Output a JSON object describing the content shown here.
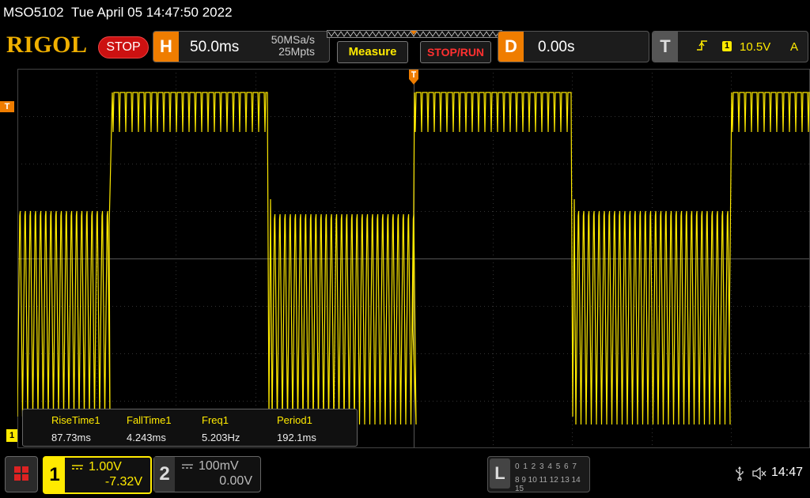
{
  "header": {
    "model": "MSO5102",
    "datetime": "Tue April 05 14:47:50 2022",
    "logo": "RIGOL",
    "run_state": "STOP"
  },
  "horizontal": {
    "badge": "H",
    "timebase": "50.0ms",
    "sample_rate": "50MSa/s",
    "memory_depth": "25Mpts"
  },
  "toolbar": {
    "measure_label": "Measure",
    "stop_run_label": "STOP/RUN"
  },
  "delay": {
    "badge": "D",
    "value": "0.00s"
  },
  "trigger": {
    "badge": "T",
    "edge_icon": "rising-edge-icon",
    "source": "1",
    "level": "10.5V",
    "mode": "A",
    "marker": "T"
  },
  "measurements": {
    "items": [
      {
        "label": "RiseTime1",
        "value": "87.73ms"
      },
      {
        "label": "FallTime1",
        "value": "4.243ms"
      },
      {
        "label": "Freq1",
        "value": "5.203Hz"
      },
      {
        "label": "Period1",
        "value": "192.1ms"
      }
    ]
  },
  "channel1": {
    "number": "1",
    "scale": "1.00V",
    "offset": "-7.32V",
    "marker": "1",
    "color": "#ffea00"
  },
  "channel2": {
    "number": "2",
    "scale": "100mV",
    "offset": "0.00V"
  },
  "logic_analyzer": {
    "badge": "L",
    "row1": "0 1 2 3  4 5 6 7",
    "row2": "8 9 10 11  12 13 14 15"
  },
  "status": {
    "usb_icon": "usb-icon",
    "sound_icon": "speaker-muted-icon",
    "time": "14:47"
  },
  "colors": {
    "accent": "#ef7d00",
    "trace": "#ffea00",
    "stop": "#cc1111"
  }
}
